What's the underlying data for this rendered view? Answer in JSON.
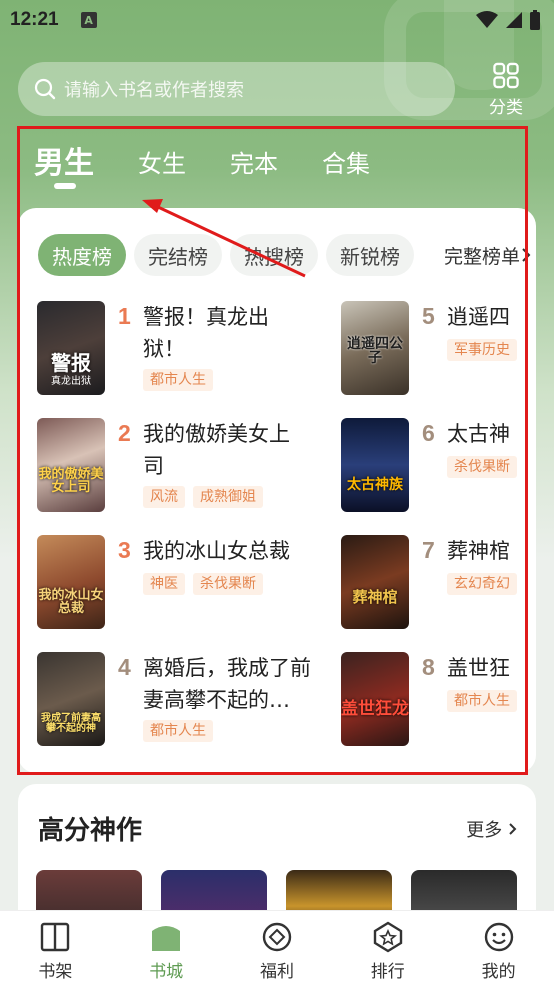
{
  "status_bar": {
    "time": "12:21",
    "notification_badge": "A"
  },
  "search": {
    "placeholder": "请输入书名或作者搜索"
  },
  "category_button": {
    "label": "分类"
  },
  "tabs": [
    {
      "label": "男生",
      "active": true
    },
    {
      "label": "女生",
      "active": false
    },
    {
      "label": "完本",
      "active": false
    },
    {
      "label": "合集",
      "active": false
    }
  ],
  "ranking": {
    "chips": [
      {
        "label": "热度榜",
        "active": true
      },
      {
        "label": "完结榜",
        "active": false
      },
      {
        "label": "热搜榜",
        "active": false
      },
      {
        "label": "新锐榜",
        "active": false
      }
    ],
    "full_list_label": "完整榜单",
    "books": [
      {
        "rank": "1",
        "title": "警报！真龙出狱！",
        "tags": [
          "都市人生"
        ],
        "cover_title": "警报",
        "cover_sub": "真龙出狱"
      },
      {
        "rank": "2",
        "title": "我的傲娇美女上司",
        "tags": [
          "风流",
          "成熟御姐"
        ],
        "cover_title": "我的傲娇美女上司",
        "cover_sub": ""
      },
      {
        "rank": "3",
        "title": "我的冰山女总裁",
        "tags": [
          "神医",
          "杀伐果断"
        ],
        "cover_title": "我的冰山女总裁",
        "cover_sub": ""
      },
      {
        "rank": "4",
        "title": "离婚后，我成了前妻高攀不起的…",
        "tags": [
          "都市人生"
        ],
        "cover_title": "我成了前妻高攀不起的神",
        "cover_sub": ""
      },
      {
        "rank": "5",
        "title": "逍遥四",
        "tags": [
          "军事历史"
        ],
        "cover_title": "逍遥四公子",
        "cover_sub": ""
      },
      {
        "rank": "6",
        "title": "太古神",
        "tags": [
          "杀伐果断"
        ],
        "cover_title": "太古神族",
        "cover_sub": ""
      },
      {
        "rank": "7",
        "title": "葬神棺",
        "tags": [
          "玄幻奇幻"
        ],
        "cover_title": "葬神棺",
        "cover_sub": ""
      },
      {
        "rank": "8",
        "title": "盖世狂",
        "tags": [
          "都市人生"
        ],
        "cover_title": "盖世狂龙",
        "cover_sub": ""
      }
    ]
  },
  "high_score": {
    "title": "高分神作",
    "more_label": "更多"
  },
  "bottom_nav": [
    {
      "label": "书架",
      "icon": "bookshelf-icon",
      "active": false
    },
    {
      "label": "书城",
      "icon": "bookstore-icon",
      "active": true
    },
    {
      "label": "福利",
      "icon": "welfare-icon",
      "active": false
    },
    {
      "label": "排行",
      "icon": "ranking-icon",
      "active": false
    },
    {
      "label": "我的",
      "icon": "profile-icon",
      "active": false
    }
  ],
  "colors": {
    "accent": "#7fb374",
    "annotation": "#e01b1b",
    "rank_hot": "#ea7a53",
    "tag_text": "#e4864f"
  }
}
